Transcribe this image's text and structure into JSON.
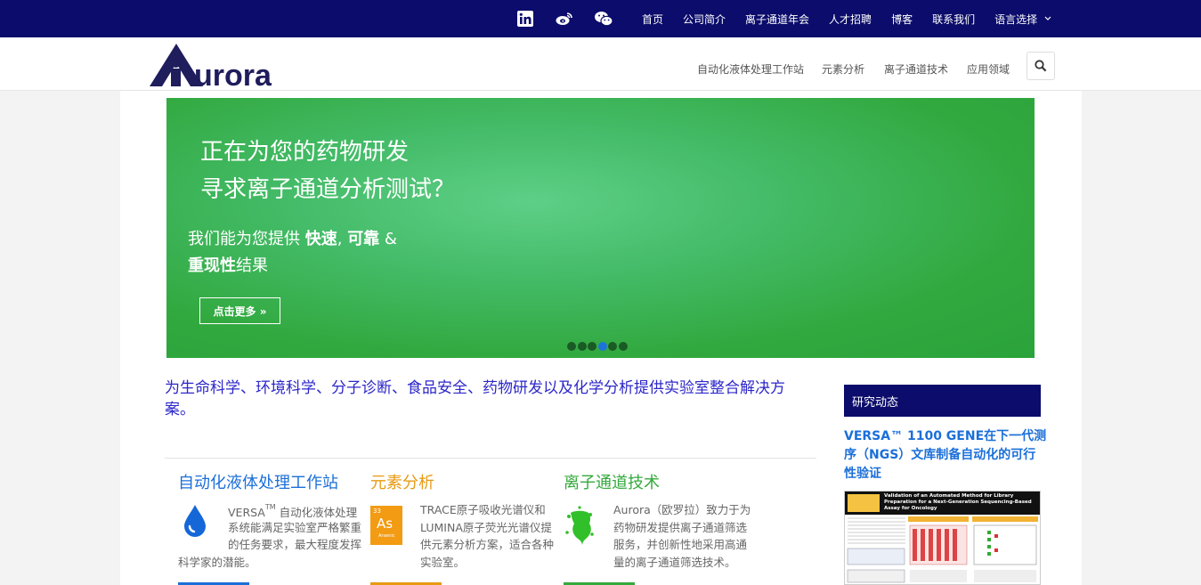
{
  "topbar": {
    "social": [
      "linkedin-icon",
      "weibo-icon",
      "wechat-icon"
    ],
    "nav": [
      "首页",
      "公司简介",
      "离子通道年会",
      "人才招聘",
      "博客",
      "联系我们"
    ],
    "language": "语言选择"
  },
  "header": {
    "logo_text": "urora",
    "menu": [
      "自动化液体处理工作站",
      "元素分析",
      "离子通道技术",
      "应用领域"
    ]
  },
  "hero": {
    "line1": "正在为您的药物研发",
    "line2": "寻求离子通道分析测试？",
    "sub1_a": "我们能为您提供 ",
    "sub1_b": "快速",
    "sub1_c": ", ",
    "sub1_d": "可靠",
    "sub1_e": " &",
    "sub2_a": "重现性",
    "sub2_b": "结果",
    "button": "点击更多 »",
    "slide_count": 6,
    "active_slide": 4
  },
  "tagline": "为生命科学、环境科学、分子诊断、食品安全、药物研发以及化学分析提供实验室整合解决方案。",
  "columns": [
    {
      "title": "自动化液体处理工作站",
      "sup": "TM",
      "line1a": "VERSA",
      "line1b": " 自动化液体处理",
      "line2": "系统能满足实验室严格繁重",
      "line3": "的任务要求，最大程度发挥",
      "line4": "科学家的潜能。",
      "color": "#1b6fd8"
    },
    {
      "title": "元素分析",
      "line1": "TRACE原子吸收光谱仪和",
      "line2": "LUMINA原子荧光光谱仪提",
      "line3": "供元素分析方案，适合各种",
      "line4": "实验室。",
      "tile_number": "33",
      "tile_symbol": "As",
      "tile_name": "Arsenic",
      "color": "#e79a12"
    },
    {
      "title": "离子通道技术",
      "line1": "Aurora（欧罗拉）致力于为",
      "line2": "药物研发提供离子通道筛选",
      "line3": "服务，并创新性地采用高通",
      "line4": "量的离子通道筛选技术。",
      "color": "#34a93c"
    }
  ],
  "sidebar": {
    "heading": "研究动态",
    "article_title": "VERSA™ 1100 GENE在下一代测序（NGS）文库制备自动化的可行性验证",
    "poster_caption": "Validation of an Automated Method for Library Preparation for a Next-Generation Sequencing-Based Assay for Oncology"
  }
}
